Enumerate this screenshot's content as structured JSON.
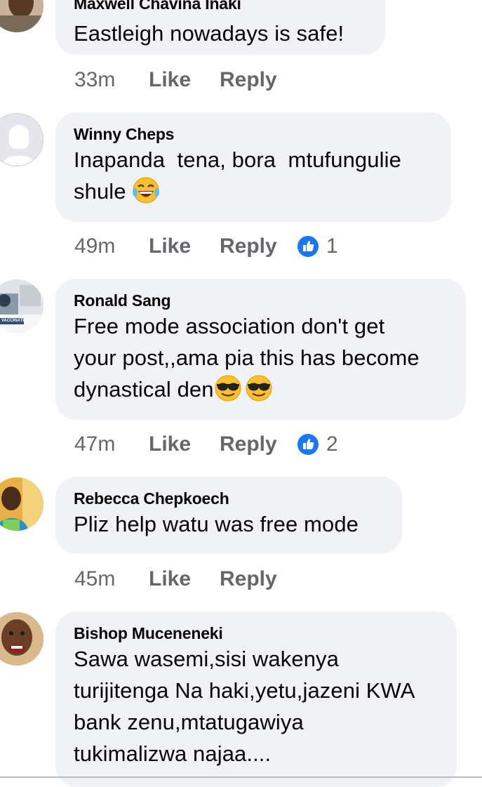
{
  "comments": [
    {
      "author": "Maxwell Chavina Inaki",
      "text": "Eastleigh nowadays is safe!",
      "time": "33m",
      "like_label": "Like",
      "reply_label": "Reply",
      "reactions": null
    },
    {
      "author": "Winny Cheps",
      "text_lines": [
        "Inapanda  tena, bora  mtufungulie",
        "shule"
      ],
      "emoji": "tears-of-joy-emoji",
      "time": "49m",
      "like_label": "Like",
      "reply_label": "Reply",
      "reactions": "1"
    },
    {
      "author": "Ronald Sang",
      "text_lines": [
        "Free mode association don't get",
        "your post,,ama pia this has become",
        "dynastical den"
      ],
      "emoji": "sunglasses-emoji",
      "avatar_badge": "VACCINATED",
      "time": "47m",
      "like_label": "Like",
      "reply_label": "Reply",
      "reactions": "2"
    },
    {
      "author": "Rebecca Chepkoech",
      "text": "Pliz help watu was free mode",
      "time": "45m",
      "like_label": "Like",
      "reply_label": "Reply",
      "reactions": null
    },
    {
      "author": "Bishop Muceneneki",
      "text_lines": [
        "Sawa wasemi,sisi wakenya",
        "turijitenga Na haki,yetu,jazeni KWA",
        "bank zenu,mtatugawiya",
        "tukimalizwa najaa...."
      ]
    }
  ],
  "colors": {
    "bubble": "#f0f2f5",
    "meta_text": "#65676b",
    "like_badge": "#1877f2"
  },
  "icons": [
    "thumbs-up-icon",
    "tears-of-joy-emoji",
    "sunglasses-emoji"
  ]
}
